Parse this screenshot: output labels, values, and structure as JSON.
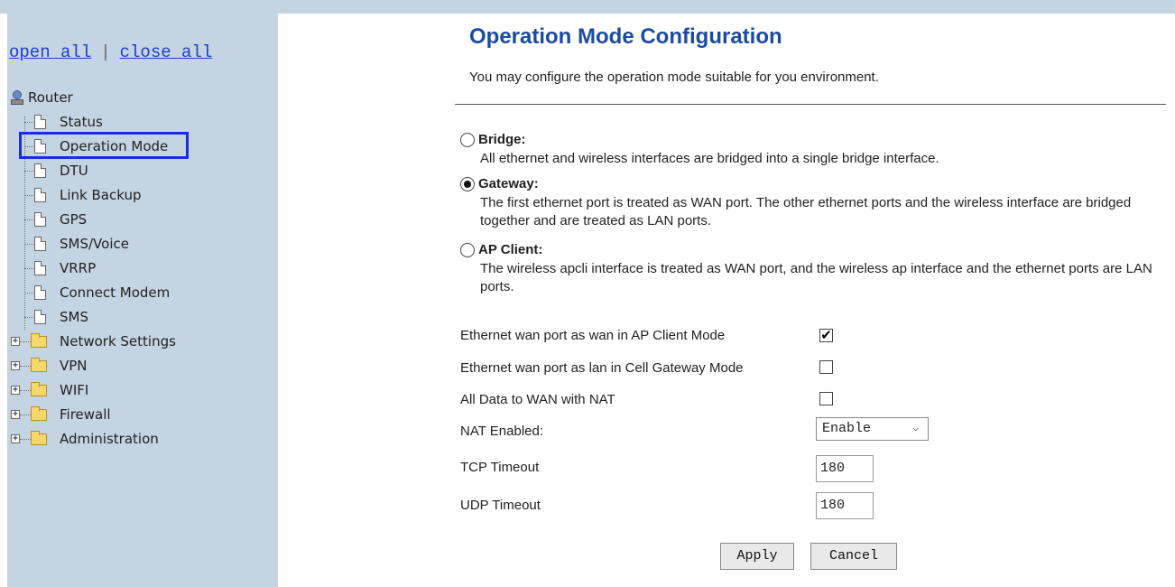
{
  "sidebar": {
    "open_all": "open all",
    "separator": "|",
    "close_all": "close all",
    "root": "Router",
    "pages": [
      "Status",
      "Operation Mode",
      "DTU",
      "Link Backup",
      "GPS",
      "SMS/Voice",
      "VRRP",
      "Connect Modem",
      "SMS"
    ],
    "folders": [
      "Network Settings",
      "VPN",
      "WIFI",
      "Firewall",
      "Administration"
    ],
    "selected": "Operation Mode"
  },
  "main": {
    "title": "Operation Mode Configuration",
    "description": "You may configure the operation mode suitable for you environment.",
    "modes": [
      {
        "label": "Bridge:",
        "description": "All ethernet and wireless interfaces are bridged into a single bridge interface.",
        "checked": false
      },
      {
        "label": "Gateway:",
        "description": "The first ethernet port is treated as WAN port. The other ethernet ports and the wireless interface are bridged together and are treated as LAN ports.",
        "checked": true
      },
      {
        "label": "AP Client:",
        "description": "The wireless apcli interface is treated as WAN port, and the wireless ap interface and the ethernet ports are LAN ports.",
        "checked": false
      }
    ],
    "options": {
      "eth_wan_ap_client": {
        "label": "Ethernet wan port as wan in AP Client Mode",
        "checked": true,
        "mark": "✔"
      },
      "eth_wan_lan_cell": {
        "label": "Ethernet wan port as lan in Cell Gateway Mode",
        "checked": false
      },
      "all_data_wan_nat": {
        "label": "All Data to WAN with NAT",
        "checked": false
      },
      "nat_enabled": {
        "label": "NAT Enabled:",
        "value": "Enable"
      },
      "tcp_timeout": {
        "label": "TCP Timeout",
        "value": "180"
      },
      "udp_timeout": {
        "label": "UDP Timeout",
        "value": "180"
      }
    },
    "buttons": {
      "apply": "Apply",
      "cancel": "Cancel"
    }
  }
}
